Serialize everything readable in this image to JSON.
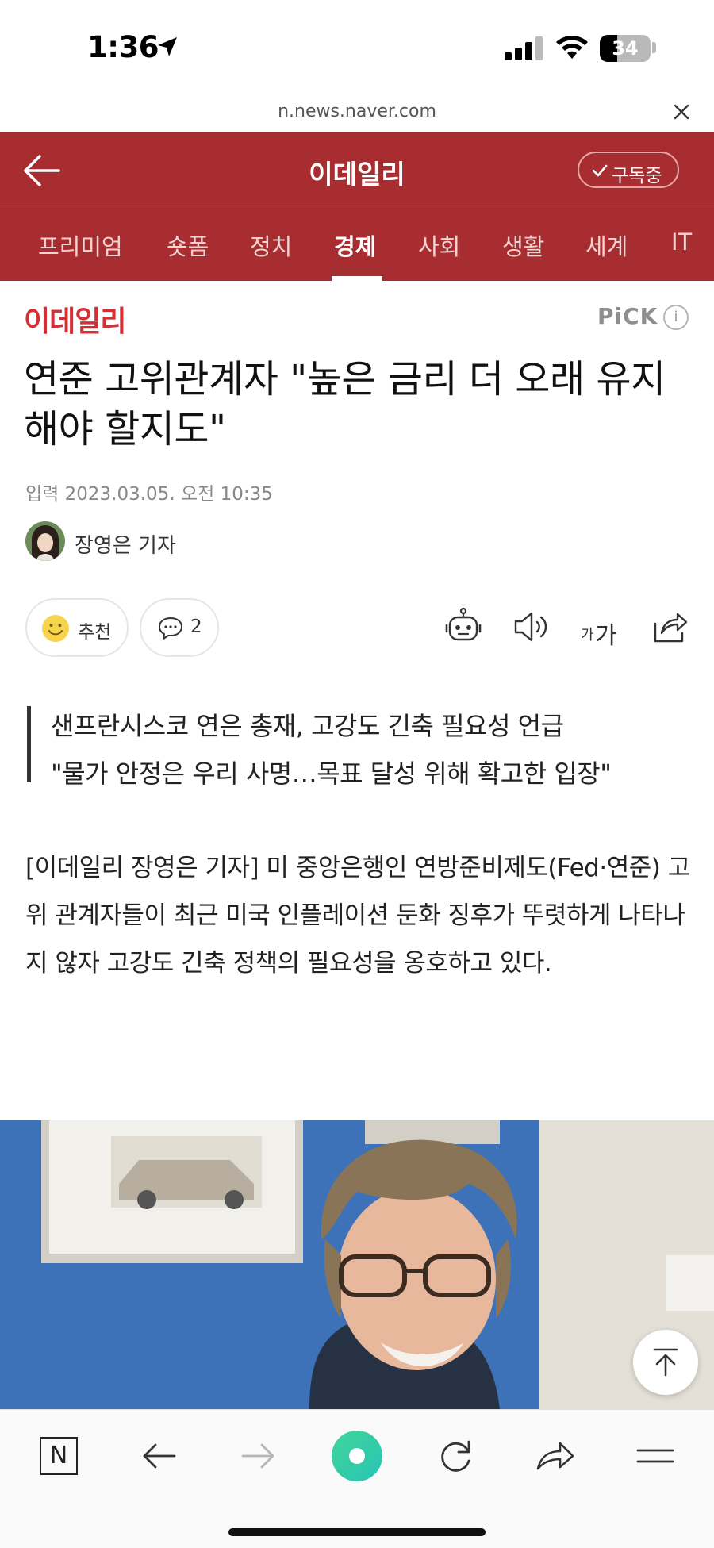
{
  "status_bar": {
    "time": "1:36",
    "battery": "34",
    "battery_level": 0.34
  },
  "browser": {
    "url": "n.news.naver.com"
  },
  "header": {
    "title": "이데일리",
    "subscribe_label": "구독중"
  },
  "nav": {
    "items": [
      {
        "label": "프리미엄"
      },
      {
        "label": "숏폼"
      },
      {
        "label": "정치"
      },
      {
        "label": "경제",
        "active": true
      },
      {
        "label": "사회"
      },
      {
        "label": "생활"
      },
      {
        "label": "세계"
      },
      {
        "label": "IT"
      }
    ]
  },
  "article": {
    "press_logo": "이데일리",
    "pick_label": "PiCK",
    "pick_info": "i",
    "headline": "연준 고위관계자 \"높은 금리 더 오래 유지해야 할지도\"",
    "datetime": "입력 2023.03.05. 오전 10:35",
    "reporter": "장영은 기자",
    "like_label": "추천",
    "comment_count": "2",
    "font_size_label_small": "가",
    "font_size_label_large": "가",
    "summary": [
      "샌프란시스코 연은 총재, 고강도 긴축 필요성 언급",
      "\"물가 안정은 우리 사명…목표 달성 위해 확고한 입장\""
    ],
    "body": "[이데일리 장영은 기자] 미 중앙은행인 연방준비제도(Fed·연준) 고위 관계자들이 최근 미국 인플레이션 둔화 징후가 뚜렷하게 나타나지 않자 고강도 긴축 정책의 필요성을 옹호하고 있다."
  },
  "toolbar": {
    "home_label": "N"
  },
  "colors": {
    "brand": "#a82d30",
    "logo_red": "#d33036",
    "green_button": "#3fd48e"
  }
}
